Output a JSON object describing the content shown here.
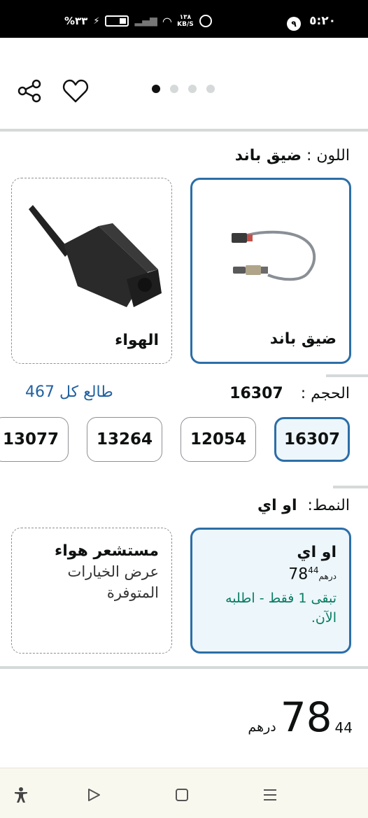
{
  "status_bar": {
    "time": "٥:٢٠",
    "notification_count": "٩",
    "battery": "%٣٣",
    "speed_value": "١٣٨",
    "speed_unit": "KB/S"
  },
  "gallery": {
    "share_icon": "share-icon",
    "wishlist_icon": "heart-icon",
    "dots": 4,
    "active_dot": 0
  },
  "color": {
    "label": "اللون  :",
    "selected": "ضيق باند",
    "options": [
      {
        "name": "ضيق باند",
        "image": "oxygen-sensor"
      },
      {
        "name": "الهواء",
        "image": "air-sensor"
      }
    ]
  },
  "size": {
    "label": "الحجم  :",
    "selected": "16307",
    "see_all": "طالع كل 467",
    "options": [
      "16307",
      "12054",
      "13264",
      "13077"
    ]
  },
  "style": {
    "label": "النمط:",
    "selected": "او اي",
    "options": [
      {
        "title": "او اي",
        "price_whole": "78",
        "price_fraction": "44",
        "currency": "درهم",
        "stock": "تبقى 1 فقط - اطلبه الآن."
      },
      {
        "title": "مستشعر هواء",
        "subtitle": "عرض الخيارات المتوفرة"
      }
    ]
  },
  "price": {
    "whole": "78",
    "fraction": "44",
    "currency": "درهم"
  },
  "nav": {
    "accessibility_icon": "accessibility-icon",
    "back_icon": "play-icon",
    "home_icon": "square-icon",
    "menu_icon": "menu-icon"
  },
  "colors": {
    "selected_border": "#2b6ea8",
    "selected_bg": "#edf6fb",
    "link": "#2162a1",
    "stock": "#067d62"
  }
}
